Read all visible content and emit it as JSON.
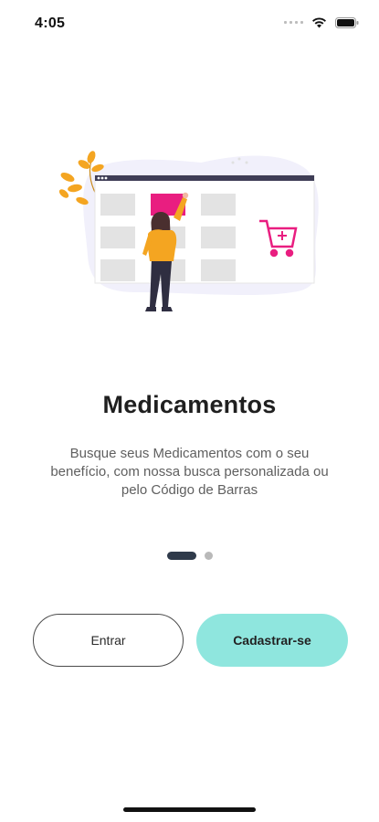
{
  "status_bar": {
    "time": "4:05",
    "icons": [
      "signal-dots-icon",
      "wifi-icon",
      "battery-icon"
    ]
  },
  "illustration": {
    "name": "woman-selecting-medication-illustration",
    "colors": {
      "accent": "#e91e80",
      "leaf": "#f4a521",
      "panel": "#e9e9e9",
      "background_blob": "#f1f0fb",
      "dark": "#2f2e41"
    }
  },
  "onboarding": {
    "title": "Medicamentos",
    "description": "Busque seus Medicamentos com o seu benefício, com nossa busca personalizada ou pelo Código de Barras",
    "page_index": 1,
    "page_count": 2
  },
  "buttons": {
    "login_label": "Entrar",
    "signup_label": "Cadastrar-se"
  },
  "colors": {
    "signup_bg": "#8fe6de",
    "pager_active": "#2f3a4a",
    "pager_inactive": "#b9b9b9"
  }
}
